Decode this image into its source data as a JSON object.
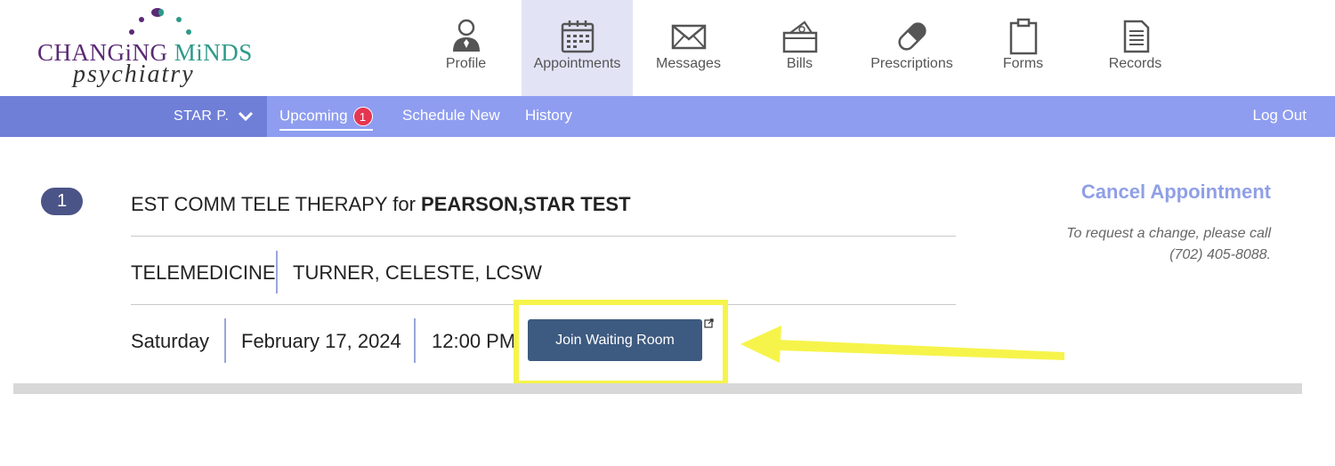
{
  "logo": {
    "word1": "CHANGiNG",
    "word2": "MiNDS",
    "subtitle": "psychiatry"
  },
  "nav": [
    {
      "label": "Profile",
      "icon": "person-icon"
    },
    {
      "label": "Appointments",
      "icon": "calendar-icon",
      "active": true
    },
    {
      "label": "Messages",
      "icon": "envelope-icon"
    },
    {
      "label": "Bills",
      "icon": "wallet-icon"
    },
    {
      "label": "Prescriptions",
      "icon": "pill-icon"
    },
    {
      "label": "Forms",
      "icon": "clipboard-icon"
    },
    {
      "label": "Records",
      "icon": "document-icon"
    }
  ],
  "subnav": {
    "user": "STAR P.",
    "tabs": [
      {
        "label": "Upcoming",
        "badge": "1",
        "active": true
      },
      {
        "label": "Schedule New"
      },
      {
        "label": "History"
      }
    ],
    "logout": "Log Out"
  },
  "appointment": {
    "number": "1",
    "title_prefix": "EST COMM TELE THERAPY for",
    "patient": "PEARSON,STAR TEST",
    "type": "TELEMEDICINE",
    "provider": "TURNER, CELESTE, LCSW",
    "day": "Saturday",
    "date": "February 17, 2024",
    "time": "12:00 PM",
    "join_label": "Join Waiting Room"
  },
  "cancel": {
    "label": "Cancel Appointment",
    "note_line1": "To request a change, please call",
    "note_line2": "(702) 405-8088."
  },
  "colors": {
    "accent": "#8e9df0",
    "accent_dark": "#6f7fd8",
    "badge": "#e63550",
    "button": "#3d5a80",
    "highlight": "#f6f44a"
  }
}
